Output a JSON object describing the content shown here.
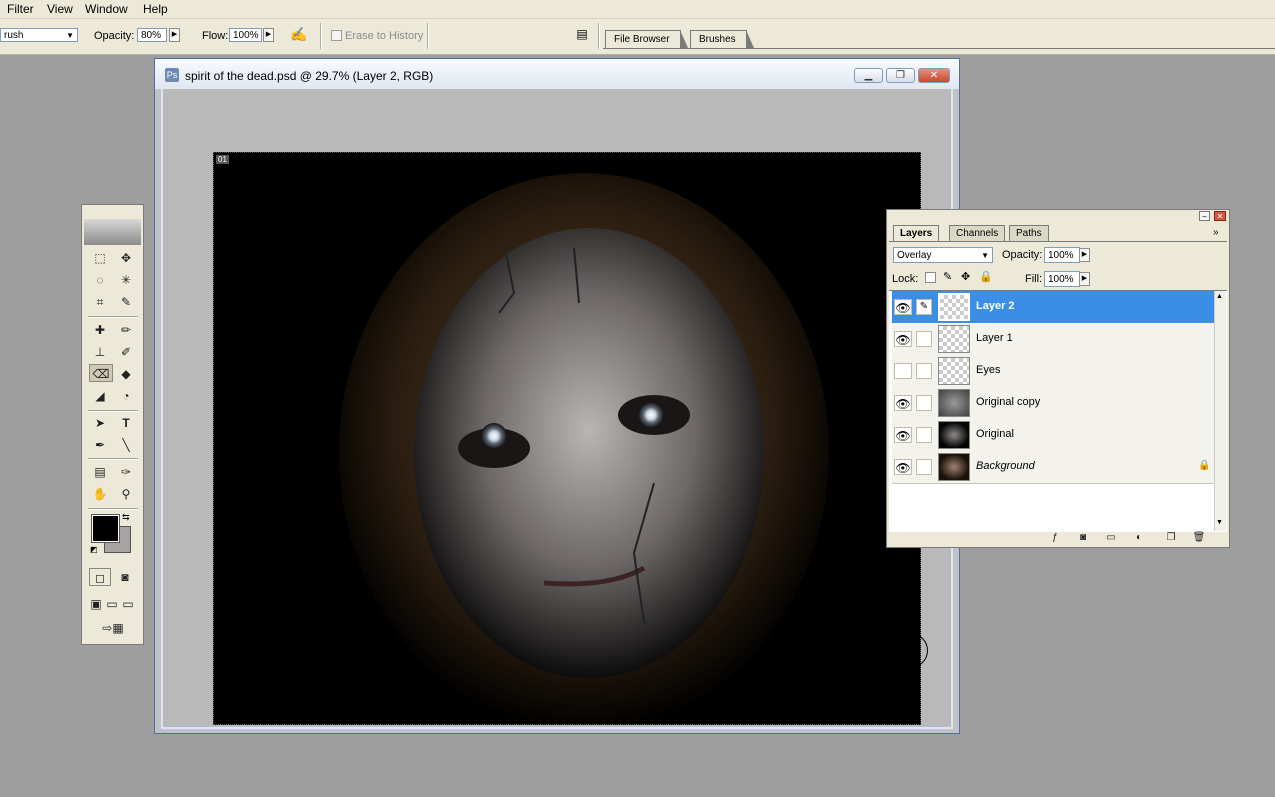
{
  "menubar": {
    "items": [
      "Filter",
      "View",
      "Window",
      "Help"
    ]
  },
  "options": {
    "tool_preset": "rush",
    "opacity_label": "Opacity:",
    "opacity_value": "80%",
    "flow_label": "Flow:",
    "flow_value": "100%",
    "erase_history_label": "Erase to History",
    "wells": [
      "File Browser",
      "Brushes"
    ]
  },
  "document": {
    "title": "spirit of the dead.psd @ 29.7% (Layer 2, RGB)",
    "canvas_tag": "01"
  },
  "layers_panel": {
    "tabs": [
      "Layers",
      "Channels",
      "Paths"
    ],
    "blend_mode": "Overlay",
    "opacity_label": "Opacity:",
    "opacity_value": "100%",
    "lock_label": "Lock:",
    "fill_label": "Fill:",
    "fill_value": "100%",
    "layers": [
      {
        "name": "Layer 2",
        "visible": true,
        "selected": true
      },
      {
        "name": "Layer 1",
        "visible": true,
        "selected": false
      },
      {
        "name": "Eyes",
        "visible": false,
        "selected": false
      },
      {
        "name": "Original copy",
        "visible": true,
        "selected": false
      },
      {
        "name": "Original",
        "visible": true,
        "selected": false
      },
      {
        "name": "Background",
        "visible": true,
        "selected": false,
        "locked": true
      }
    ]
  },
  "colors": {
    "foreground": "#000000",
    "background": "#a8a4a4",
    "selection": "#3a8ee6"
  }
}
